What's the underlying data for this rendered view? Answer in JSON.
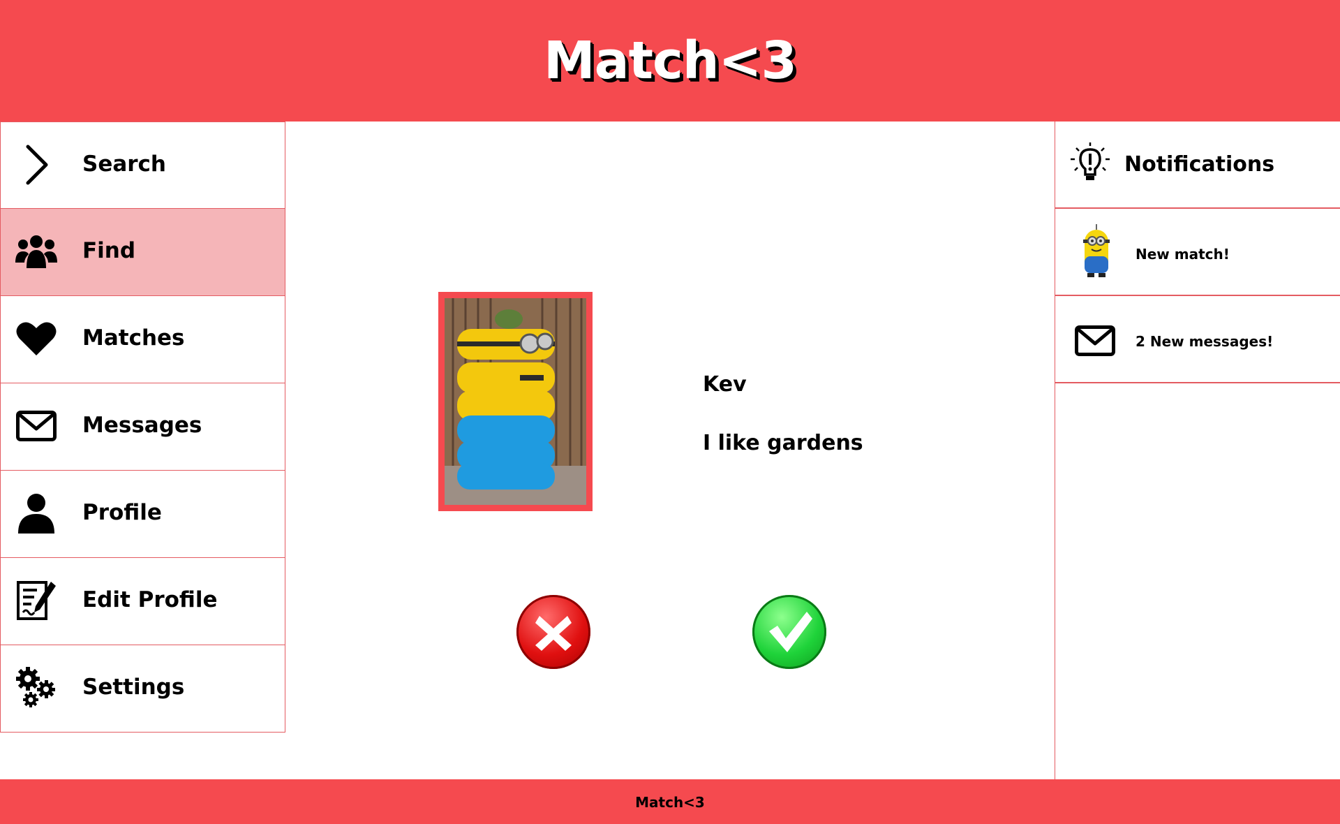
{
  "header": {
    "logo": "Match<3"
  },
  "footer": {
    "text": "Match<3"
  },
  "sidebar": {
    "items": [
      {
        "label": "Search",
        "icon": "chevron-right-icon"
      },
      {
        "label": "Find",
        "icon": "people-icon",
        "active": true
      },
      {
        "label": "Matches",
        "icon": "heart-icon"
      },
      {
        "label": "Messages",
        "icon": "envelope-icon"
      },
      {
        "label": "Profile",
        "icon": "person-icon"
      },
      {
        "label": "Edit Profile",
        "icon": "edit-document-icon"
      },
      {
        "label": "Settings",
        "icon": "gears-icon"
      }
    ]
  },
  "profile": {
    "name": "Kev",
    "bio": "I like gardens",
    "photo": "minion-tire-stack-photo"
  },
  "actions": {
    "reject_icon": "x-icon",
    "accept_icon": "checkmark-icon"
  },
  "notifications": {
    "title": "Notifications",
    "title_icon": "lightbulb-icon",
    "items": [
      {
        "label": "New match!",
        "icon": "minion-avatar-icon"
      },
      {
        "label": "2 New messages!",
        "icon": "envelope-icon"
      }
    ]
  },
  "colors": {
    "brand": "#f54a4f",
    "active_nav": "#f5b5b8",
    "reject": "#e01010",
    "accept": "#1fd33a"
  }
}
